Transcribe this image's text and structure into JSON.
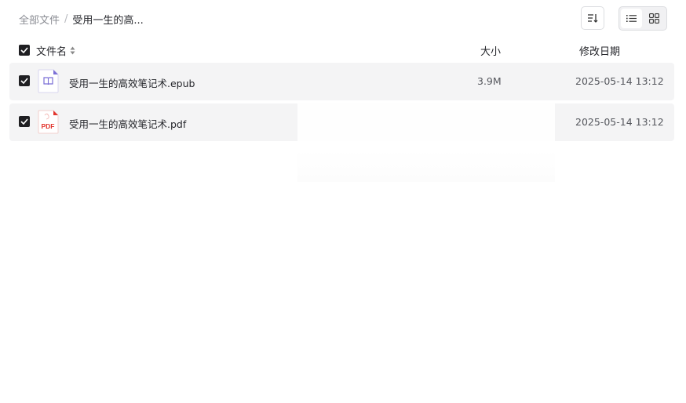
{
  "breadcrumb": {
    "root": "全部文件",
    "separator": "/",
    "current": "受用一生的高..."
  },
  "toolbar": {
    "sort_icon": "sort-icon",
    "list_view_icon": "list-view-icon",
    "grid_view_icon": "grid-view-icon",
    "active_view": "list"
  },
  "table": {
    "headers": {
      "name": "文件名",
      "size": "大小",
      "date": "修改日期"
    },
    "select_all_checked": true,
    "rows": [
      {
        "checked": true,
        "icon": "epub-file-icon",
        "name": "受用一生的高效笔记术.epub",
        "size": "3.9M",
        "date": "2025-05-14 13:12"
      },
      {
        "checked": true,
        "icon": "pdf-file-icon",
        "icon_label": "PDF",
        "name": "受用一生的高效笔记术.pdf",
        "size": "",
        "date": "2025-05-14 13:12"
      }
    ]
  },
  "colors": {
    "row_background": "#f4f4f5",
    "checkbox": "#1f1f22",
    "epub_accent": "#7b6fd6",
    "pdf_accent": "#e2352d"
  }
}
